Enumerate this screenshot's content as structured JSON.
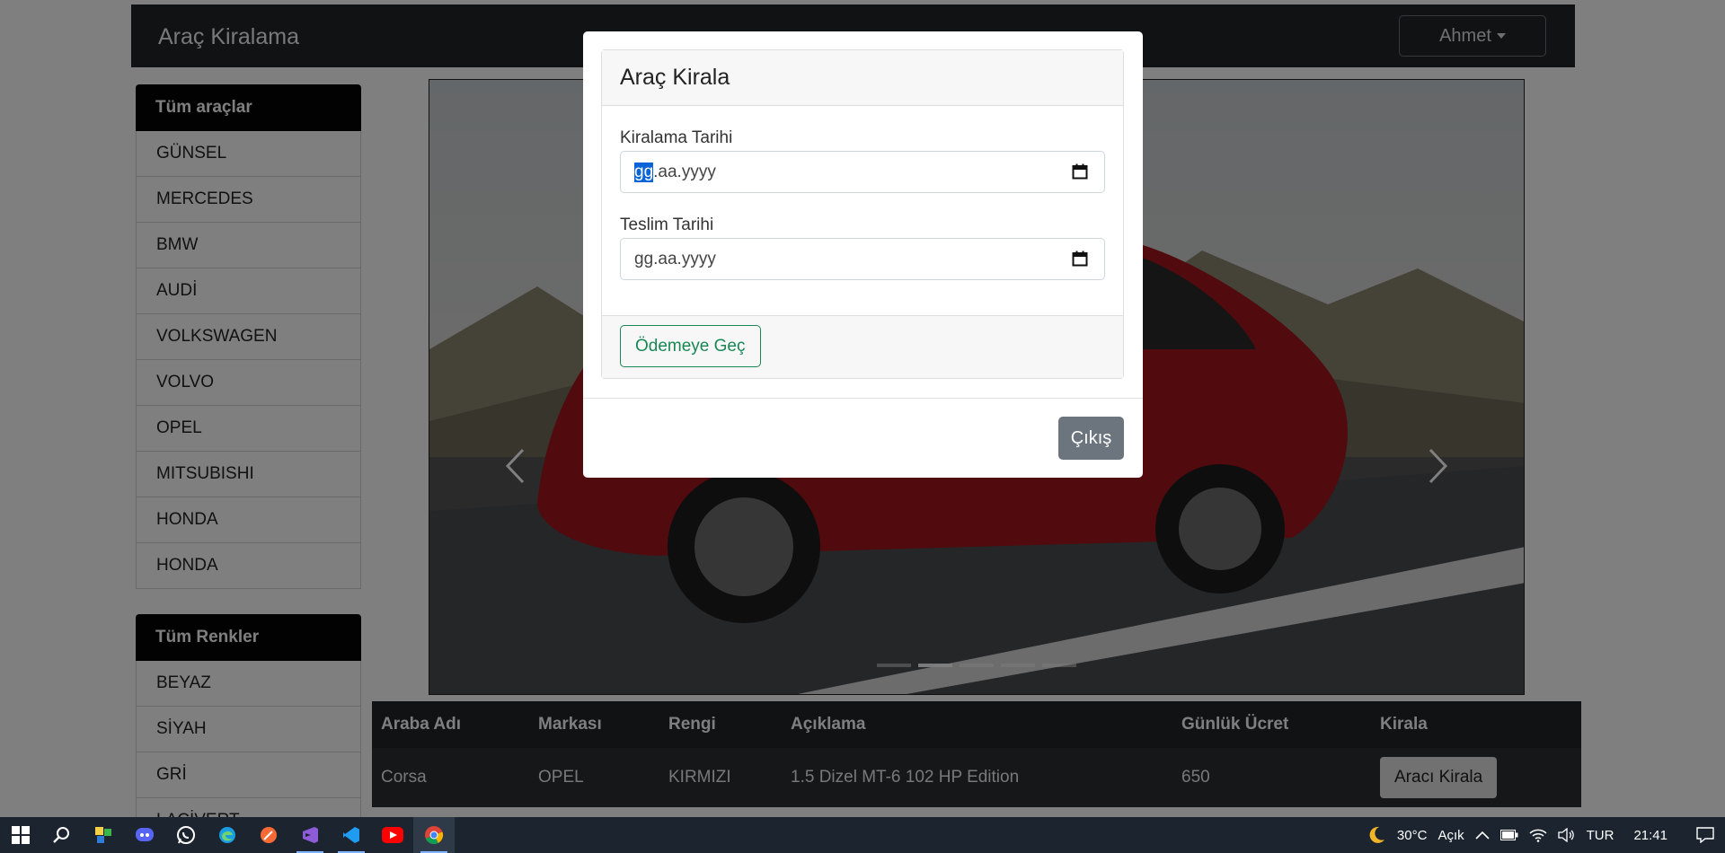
{
  "navbar": {
    "brand": "Araç Kiralama",
    "user": "Ahmet"
  },
  "sidebar": {
    "brands_header": "Tüm araçlar",
    "brands": [
      "GÜNSEL",
      "MERCEDES",
      "BMW",
      "AUDİ",
      "VOLKSWAGEN",
      "VOLVO",
      "OPEL",
      "MITSUBISHI",
      "HONDA",
      "HONDA"
    ],
    "colors_header": "Tüm Renkler",
    "colors": [
      "BEYAZ",
      "SİYAH",
      "GRİ",
      "LACİVERT"
    ]
  },
  "carousel": {
    "slide_count": 5,
    "active_index": 1
  },
  "table": {
    "headers": [
      "Araba Adı",
      "Markası",
      "Rengi",
      "Açıklama",
      "Günlük Ücret",
      "Kirala"
    ],
    "rows": [
      {
        "name": "Corsa",
        "brand": "OPEL",
        "color": "KIRMIZI",
        "description": "1.5 Dizel MT-6 102 HP Edition",
        "price": "650",
        "action": "Aracı Kirala"
      }
    ]
  },
  "modal": {
    "title": "Araç Kirala",
    "rent_date_label": "Kiralama Tarihi",
    "rent_date_placeholder_sel": "gg",
    "rent_date_placeholder_rest": ".aa.yyyy",
    "return_date_label": "Teslim Tarihi",
    "return_date_placeholder": "gg.aa.yyyy",
    "pay_button": "Ödemeye Geç",
    "close_button": "Çıkış"
  },
  "taskbar": {
    "apps": [
      "start-icon",
      "search-icon",
      "sticky-notes-icon",
      "discord-icon",
      "whatsapp-icon",
      "edge-icon",
      "postman-icon",
      "visual-studio-icon",
      "vscode-icon",
      "youtube-icon",
      "chrome-icon"
    ],
    "weather_temp": "30°C",
    "weather_text": "Açık",
    "language": "TUR",
    "time": "21:41"
  },
  "colors": {
    "accent_green": "#198754",
    "close_gray": "#6c757d",
    "navbar_dark": "#212529"
  }
}
